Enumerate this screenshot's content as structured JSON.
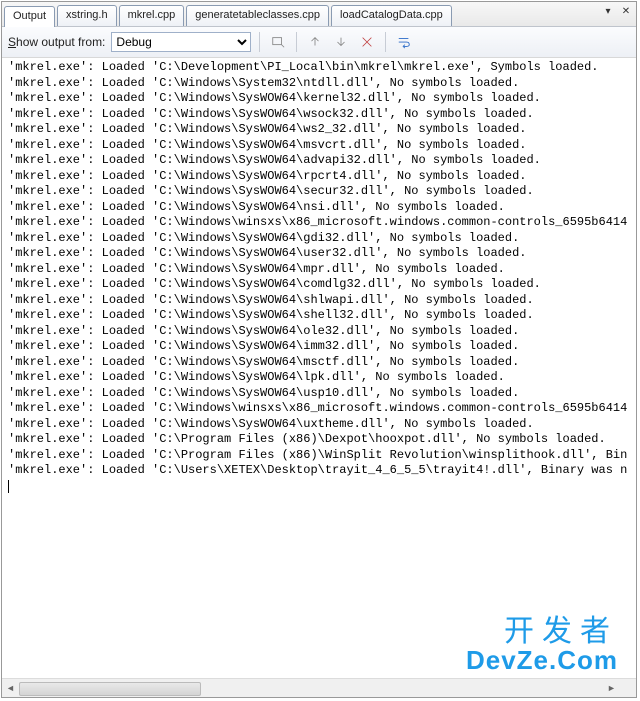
{
  "tabs": [
    {
      "label": "Output",
      "active": true
    },
    {
      "label": "xstring.h",
      "active": false
    },
    {
      "label": "mkrel.cpp",
      "active": false
    },
    {
      "label": "generatetableclasses.cpp",
      "active": false
    },
    {
      "label": "loadCatalogData.cpp",
      "active": false
    }
  ],
  "toolbar": {
    "show_from_label": "Show output from:",
    "source_selected": "Debug"
  },
  "output_lines": [
    "'mkrel.exe': Loaded 'C:\\Development\\PI_Local\\bin\\mkrel\\mkrel.exe', Symbols loaded.",
    "'mkrel.exe': Loaded 'C:\\Windows\\System32\\ntdll.dll', No symbols loaded.",
    "'mkrel.exe': Loaded 'C:\\Windows\\SysWOW64\\kernel32.dll', No symbols loaded.",
    "'mkrel.exe': Loaded 'C:\\Windows\\SysWOW64\\wsock32.dll', No symbols loaded.",
    "'mkrel.exe': Loaded 'C:\\Windows\\SysWOW64\\ws2_32.dll', No symbols loaded.",
    "'mkrel.exe': Loaded 'C:\\Windows\\SysWOW64\\msvcrt.dll', No symbols loaded.",
    "'mkrel.exe': Loaded 'C:\\Windows\\SysWOW64\\advapi32.dll', No symbols loaded.",
    "'mkrel.exe': Loaded 'C:\\Windows\\SysWOW64\\rpcrt4.dll', No symbols loaded.",
    "'mkrel.exe': Loaded 'C:\\Windows\\SysWOW64\\secur32.dll', No symbols loaded.",
    "'mkrel.exe': Loaded 'C:\\Windows\\SysWOW64\\nsi.dll', No symbols loaded.",
    "'mkrel.exe': Loaded 'C:\\Windows\\winsxs\\x86_microsoft.windows.common-controls_6595b6414",
    "'mkrel.exe': Loaded 'C:\\Windows\\SysWOW64\\gdi32.dll', No symbols loaded.",
    "'mkrel.exe': Loaded 'C:\\Windows\\SysWOW64\\user32.dll', No symbols loaded.",
    "'mkrel.exe': Loaded 'C:\\Windows\\SysWOW64\\mpr.dll', No symbols loaded.",
    "'mkrel.exe': Loaded 'C:\\Windows\\SysWOW64\\comdlg32.dll', No symbols loaded.",
    "'mkrel.exe': Loaded 'C:\\Windows\\SysWOW64\\shlwapi.dll', No symbols loaded.",
    "'mkrel.exe': Loaded 'C:\\Windows\\SysWOW64\\shell32.dll', No symbols loaded.",
    "'mkrel.exe': Loaded 'C:\\Windows\\SysWOW64\\ole32.dll', No symbols loaded.",
    "'mkrel.exe': Loaded 'C:\\Windows\\SysWOW64\\imm32.dll', No symbols loaded.",
    "'mkrel.exe': Loaded 'C:\\Windows\\SysWOW64\\msctf.dll', No symbols loaded.",
    "'mkrel.exe': Loaded 'C:\\Windows\\SysWOW64\\lpk.dll', No symbols loaded.",
    "'mkrel.exe': Loaded 'C:\\Windows\\SysWOW64\\usp10.dll', No symbols loaded.",
    "'mkrel.exe': Loaded 'C:\\Windows\\winsxs\\x86_microsoft.windows.common-controls_6595b6414",
    "'mkrel.exe': Loaded 'C:\\Windows\\SysWOW64\\uxtheme.dll', No symbols loaded.",
    "'mkrel.exe': Loaded 'C:\\Program Files (x86)\\Dexpot\\hooxpot.dll', No symbols loaded.",
    "'mkrel.exe': Loaded 'C:\\Program Files (x86)\\WinSplit Revolution\\winsplithook.dll', Bin",
    "'mkrel.exe': Loaded 'C:\\Users\\XETEX\\Desktop\\trayit_4_6_5_5\\trayit4!.dll', Binary was n"
  ],
  "watermark": {
    "line1": "开发者",
    "line2": "DevZe.Com"
  }
}
